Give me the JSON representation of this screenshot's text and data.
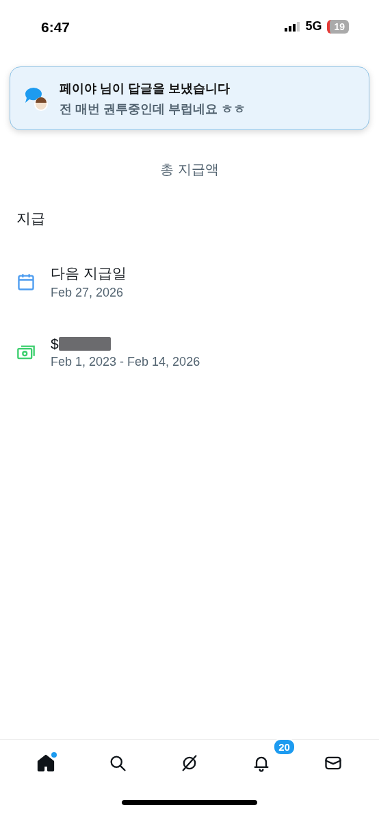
{
  "status_bar": {
    "time": "6:47",
    "network": "5G",
    "battery": "19"
  },
  "notification": {
    "title": "페이야 님이 답글을 보냈습니다",
    "message": "전 매번 권투중인데 부럽네요 ㅎㅎ"
  },
  "summary": {
    "label": "총 지급액"
  },
  "section_title": "지급",
  "rows": [
    {
      "kind": "date",
      "title": "다음 지급일",
      "subtitle": "Feb 27, 2026"
    },
    {
      "kind": "amount",
      "title": "$",
      "redacted": true,
      "subtitle": "Feb 1, 2023 - Feb 14, 2026"
    }
  ],
  "tab_bar": [
    {
      "kind": "home",
      "selected": true,
      "dot": true
    },
    {
      "kind": "search",
      "selected": false,
      "dot": false
    },
    {
      "kind": "explore",
      "selected": false,
      "dot": false
    },
    {
      "kind": "bell",
      "selected": false,
      "dot": false,
      "badge": "20"
    },
    {
      "kind": "mail",
      "selected": false,
      "dot": false
    }
  ]
}
